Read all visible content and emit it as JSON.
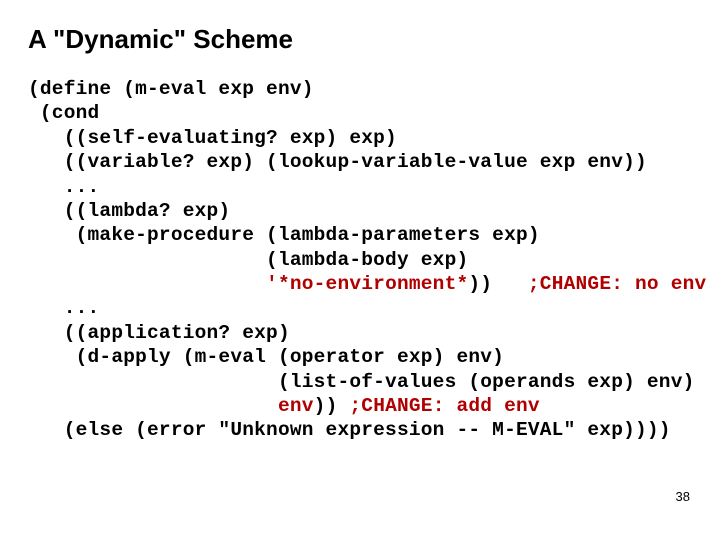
{
  "title": "A \"Dynamic\" Scheme",
  "code": {
    "l1": "(define (m-eval exp env)",
    "l2": " (cond",
    "l3": "   ((self-evaluating? exp) exp)",
    "l4": "   ((variable? exp) (lookup-variable-value exp env))",
    "l5": "   ...",
    "l6": "   ((lambda? exp)",
    "l7": "    (make-procedure (lambda-parameters exp)",
    "l8": "                    (lambda-body exp)",
    "l9a": "                    ",
    "l9b": "'*no-environment*",
    "l9c": "))   ",
    "l9d": ";CHANGE: no env",
    "l10": "   ...",
    "l11": "   ((application? exp)",
    "l12": "    (d-apply (m-eval (operator exp) env)",
    "l13": "                     (list-of-values (operands exp) env)",
    "l14a": "                     ",
    "l14b": "env",
    "l14c": ")) ",
    "l14d": ";CHANGE: add env",
    "l15": "   (else (error \"Unknown expression -- M-EVAL\" exp))))"
  },
  "page_number": "38"
}
